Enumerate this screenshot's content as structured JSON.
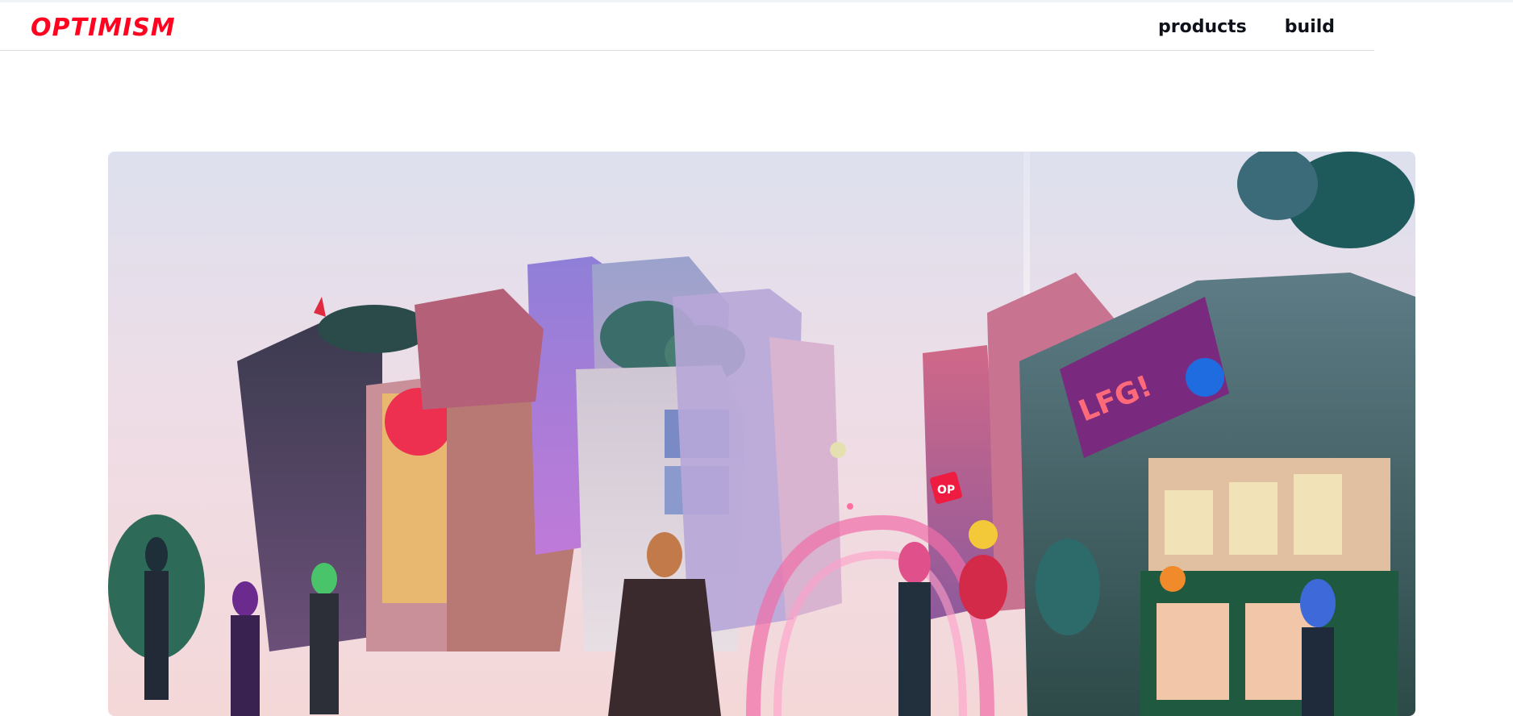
{
  "header": {
    "logo_text": "OPTIMISM",
    "nav": [
      {
        "label": "products"
      },
      {
        "label": "build"
      }
    ]
  },
  "hero": {
    "billboard_text": "LFG!",
    "badge_text": "OP"
  },
  "colors": {
    "brand": "#ff0420",
    "nav_text": "#0f111a",
    "divider": "#dcdcdc"
  }
}
